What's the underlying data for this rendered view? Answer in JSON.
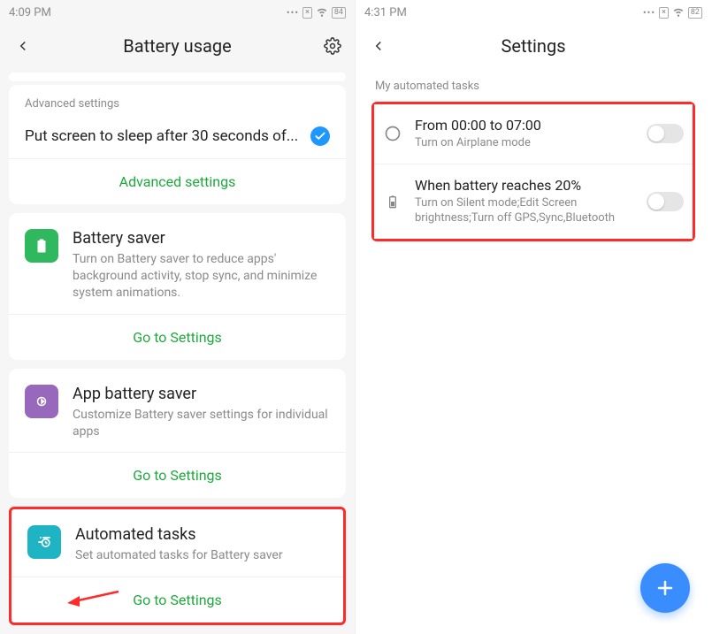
{
  "left": {
    "status_time": "4:09 PM",
    "status_battery": "84",
    "nav_title": "Battery usage",
    "advanced_header": "Advanced settings",
    "sleep_row_text": "Put screen to sleep after 30 seconds of...",
    "advanced_link": "Advanced settings",
    "cards": [
      {
        "title": "Battery saver",
        "desc": "Turn on Battery saver to reduce apps' background activity, stop sync, and minimize system animations.",
        "link": "Go to Settings"
      },
      {
        "title": "App battery saver",
        "desc": "Customize Battery saver settings for individual apps",
        "link": "Go to Settings"
      },
      {
        "title": "Automated tasks",
        "desc": "Set automated tasks for Battery saver",
        "link": "Go to Settings"
      }
    ]
  },
  "right": {
    "status_time": "4:31 PM",
    "status_battery": "82",
    "nav_title": "Settings",
    "section_header": "My automated tasks",
    "tasks": [
      {
        "title": "From 00:00 to 07:00",
        "desc": "Turn on Airplane mode"
      },
      {
        "title": "When battery reaches 20%",
        "desc": "Turn on Silent mode;Edit Screen brightness;Turn off GPS,Sync,Bluetooth"
      }
    ]
  }
}
